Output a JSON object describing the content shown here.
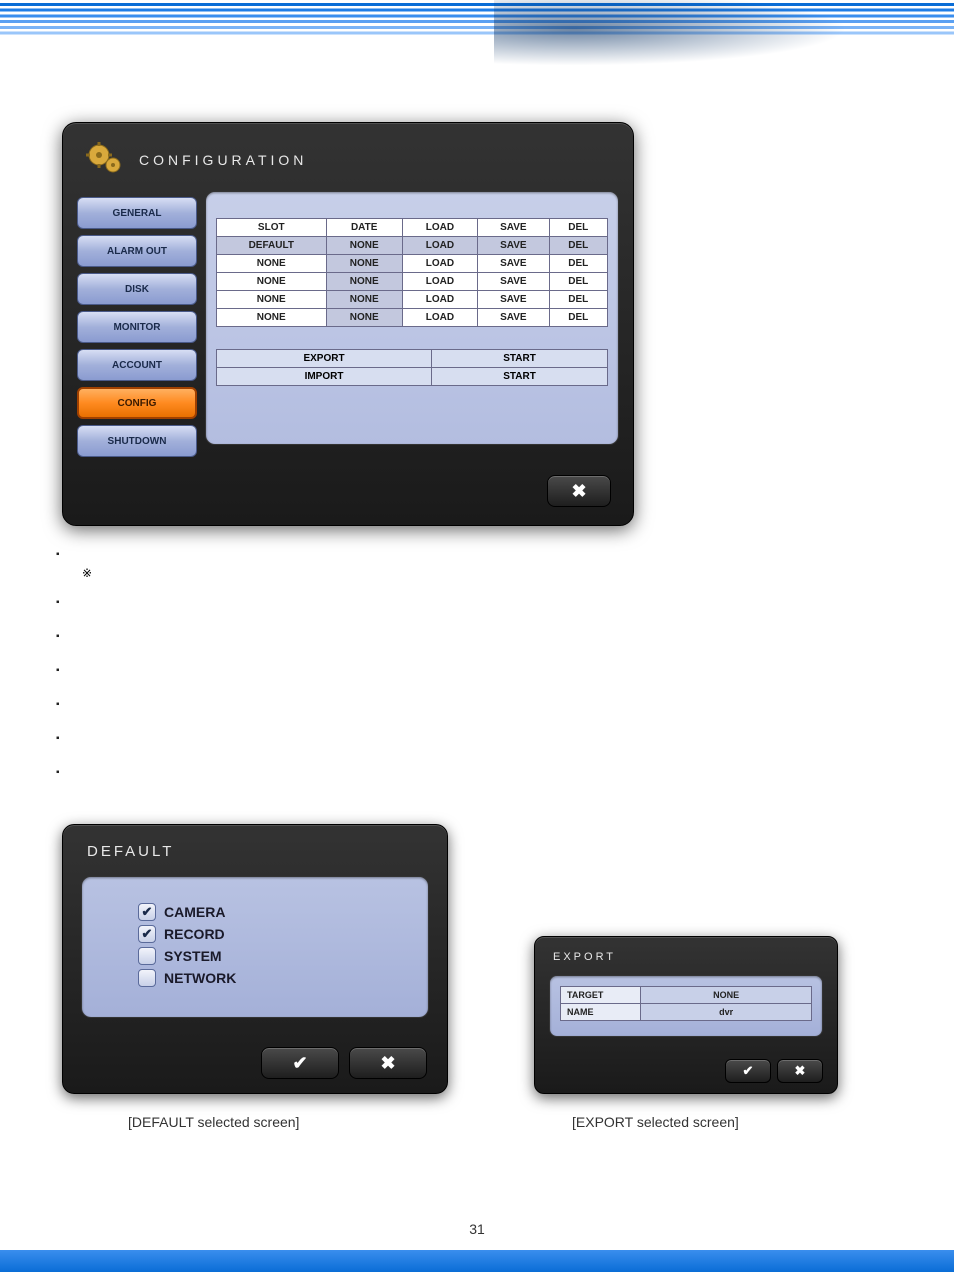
{
  "page_number": "31",
  "config_window": {
    "title": "CONFIGURATION",
    "sidebar": [
      {
        "label": "GENERAL",
        "active": false
      },
      {
        "label": "ALARM OUT",
        "active": false
      },
      {
        "label": "DISK",
        "active": false
      },
      {
        "label": "MONITOR",
        "active": false
      },
      {
        "label": "ACCOUNT",
        "active": false
      },
      {
        "label": "CONFIG",
        "active": true
      },
      {
        "label": "SHUTDOWN",
        "active": false
      }
    ],
    "table": {
      "headers": [
        "SLOT",
        "DATE",
        "LOAD",
        "SAVE",
        "DEL"
      ],
      "rows": [
        {
          "slot": "DEFAULT",
          "date": "NONE",
          "load": "LOAD",
          "save": "SAVE",
          "del": "DEL",
          "highlight": true
        },
        {
          "slot": "NONE",
          "date": "NONE",
          "load": "LOAD",
          "save": "SAVE",
          "del": "DEL",
          "highlight": false
        },
        {
          "slot": "NONE",
          "date": "NONE",
          "load": "LOAD",
          "save": "SAVE",
          "del": "DEL",
          "highlight": false
        },
        {
          "slot": "NONE",
          "date": "NONE",
          "load": "LOAD",
          "save": "SAVE",
          "del": "DEL",
          "highlight": false
        },
        {
          "slot": "NONE",
          "date": "NONE",
          "load": "LOAD",
          "save": "SAVE",
          "del": "DEL",
          "highlight": false
        }
      ]
    },
    "export_label": "EXPORT",
    "export_start": "START",
    "import_label": "IMPORT",
    "import_start": "START"
  },
  "default_window": {
    "title": "DEFAULT",
    "items": [
      {
        "label": "CAMERA",
        "checked": true
      },
      {
        "label": "RECORD",
        "checked": true
      },
      {
        "label": "SYSTEM",
        "checked": false
      },
      {
        "label": "NETWORK",
        "checked": false
      }
    ]
  },
  "export_window": {
    "title": "EXPORT",
    "rows": [
      {
        "key": "TARGET",
        "value": "NONE"
      },
      {
        "key": "NAME",
        "value": "dvr"
      }
    ]
  },
  "caption_default": "[DEFAULT selected screen]",
  "caption_export": "[EXPORT selected screen]"
}
